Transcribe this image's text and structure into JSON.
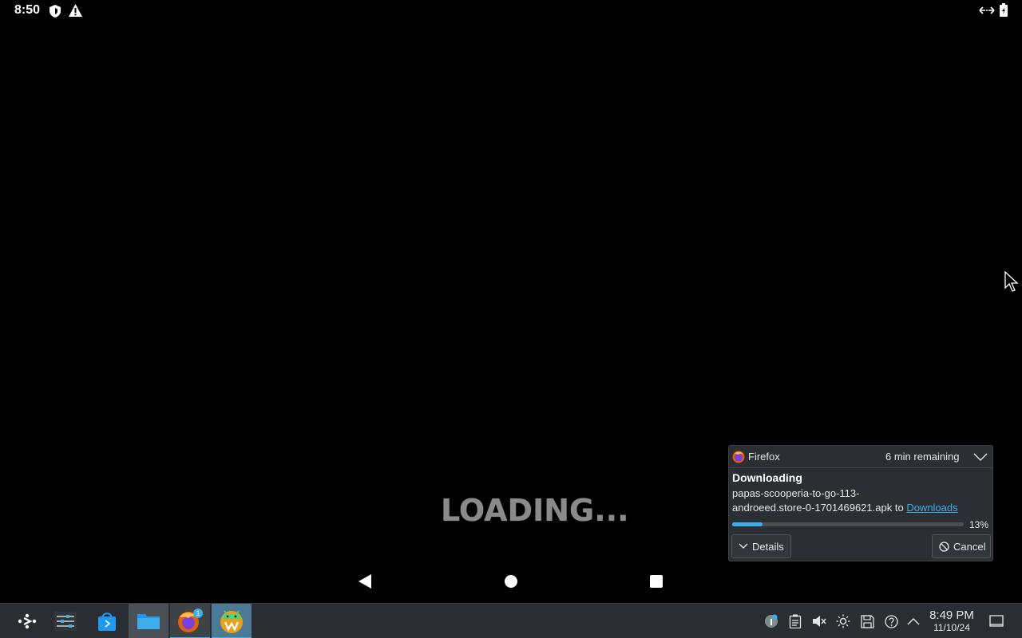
{
  "status_bar": {
    "time": "8:50",
    "icons": [
      "shield-icon",
      "warning-icon",
      "data-transfer-icon",
      "battery-icon"
    ]
  },
  "app_screen": {
    "loading_text": "LOADING..."
  },
  "nav_bar": {
    "buttons": [
      "back",
      "home",
      "recents"
    ]
  },
  "notification": {
    "app_name": "Firefox",
    "remaining": "6 min remaining",
    "title": "Downloading",
    "filename_line1": "papas-scooperia-to-go-113-",
    "filename_line2": "androeed.store-0-1701469621.apk",
    "to_text": "to",
    "destination_link": "Downloads",
    "progress_percent": 13,
    "progress_label": "13%",
    "details_label": "Details",
    "cancel_label": "Cancel"
  },
  "taskbar": {
    "apps": [
      {
        "name": "Application Launcher",
        "icon": "launcher-icon"
      },
      {
        "name": "Audio Mixer",
        "icon": "mixer-icon"
      },
      {
        "name": "Discover Store",
        "icon": "store-icon"
      },
      {
        "name": "Dolphin Files",
        "icon": "folder-icon"
      },
      {
        "name": "Firefox",
        "icon": "firefox-icon",
        "badge": "1"
      },
      {
        "name": "Waydroid",
        "icon": "waydroid-icon"
      }
    ],
    "clock": {
      "time": "8:49 PM",
      "date": "11/10/24"
    }
  },
  "colors": {
    "accent": "#3daee9",
    "panel": "#2a2e32",
    "popup": "#2b2e33"
  }
}
